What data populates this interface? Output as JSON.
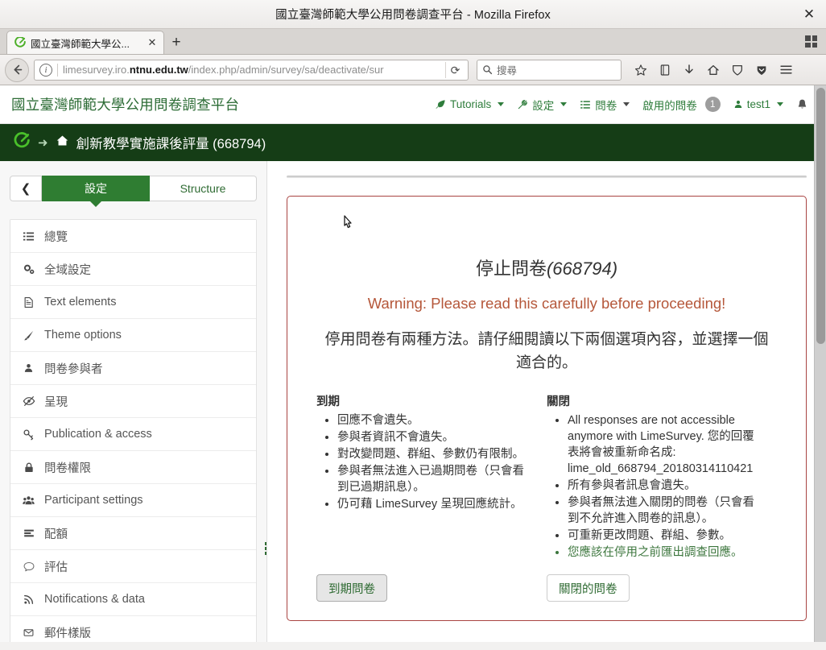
{
  "browser": {
    "window_title": "國立臺灣師範大學公用問卷調查平台 - Mozilla Firefox",
    "close_label": "✕",
    "tab": {
      "title": "國立臺灣師範大學公...",
      "close_label": "✕",
      "new_tab_label": "+"
    },
    "toolbar": {
      "back_label": "❮",
      "url_prefix": "limesurvey.iro.",
      "url_domain": "ntnu.edu.tw",
      "url_path": "/index.php/admin/survey/sa/deactivate/sur",
      "info_label": "i",
      "reload_label": "⟳",
      "search_placeholder": "搜尋"
    }
  },
  "app": {
    "brand": "國立臺灣師範大學公用問卷調查平台",
    "menu": [
      {
        "label": "Tutorials",
        "icon": "rocket-icon",
        "caret": true
      },
      {
        "label": "設定",
        "icon": "wrench-icon",
        "caret": true
      },
      {
        "label": "問卷",
        "icon": "list-icon",
        "caret": true
      },
      {
        "label": "啟用的問卷",
        "icon": "",
        "badge": "1",
        "caret": false
      },
      {
        "label": "test1",
        "icon": "user-icon",
        "caret": true
      },
      {
        "label": "",
        "icon": "bell-icon",
        "caret": false
      }
    ],
    "breadcrumb": {
      "logo": "limesurvey-logo-icon",
      "arrow": "➜",
      "home_icon": "home-icon",
      "text": "創新教學實施課後評量 (668794)"
    }
  },
  "sidebar": {
    "collapse_label": "❮",
    "tabs": [
      {
        "label": "設定",
        "active": true
      },
      {
        "label": "Structure",
        "active": false
      }
    ],
    "items": [
      {
        "label": "總覽",
        "icon": "list-icon"
      },
      {
        "label": "全域設定",
        "icon": "gears-icon"
      },
      {
        "label": "Text elements",
        "icon": "file-text-icon"
      },
      {
        "label": "Theme options",
        "icon": "paintbrush-icon"
      },
      {
        "label": "問卷參與者",
        "icon": "user-icon"
      },
      {
        "label": "呈現",
        "icon": "eye-slash-icon"
      },
      {
        "label": "Publication & access",
        "icon": "key-icon"
      },
      {
        "label": "問卷權限",
        "icon": "lock-icon"
      },
      {
        "label": "Participant settings",
        "icon": "users-icon"
      },
      {
        "label": "配額",
        "icon": "bars-icon"
      },
      {
        "label": "評估",
        "icon": "comment-icon"
      },
      {
        "label": "Notifications & data",
        "icon": "rss-icon"
      },
      {
        "label": "郵件樣版",
        "icon": "envelope-icon"
      }
    ]
  },
  "main": {
    "title_prefix": "停止問卷",
    "title_id": "(668794)",
    "warning": "Warning: Please read this carefully before proceeding!",
    "lead": "停用問卷有兩種方法。請仔細閱讀以下兩個選項內容，並選擇一個適合的。",
    "columns": [
      {
        "heading": "到期",
        "bullets": [
          {
            "text": "回應不會遺失。",
            "note": false
          },
          {
            "text": "參與者資訊不會遺失。",
            "note": false
          },
          {
            "text": "對改變問題、群組、參數仍有限制。",
            "note": false
          },
          {
            "text": "參與者無法進入已過期問卷（只會看到已過期訊息）。",
            "note": false
          },
          {
            "text": "仍可藉 LimeSurvey 呈現回應統計。",
            "note": false
          }
        ],
        "button": "到期問卷",
        "button_hovered": true
      },
      {
        "heading": "關閉",
        "bullets": [
          {
            "text": "All responses are not accessible anymore with LimeSurvey. 您的回覆表將會被重新命名成: lime_old_668794_20180314110421",
            "note": false
          },
          {
            "text": "所有參與者訊息會遺失。",
            "note": false
          },
          {
            "text": "參與者無法進入關閉的問卷（只會看到不允許進入問卷的訊息）。",
            "note": false
          },
          {
            "text": "可重新更改問題、群組、參數。",
            "note": false
          },
          {
            "text": "您應該在停用之前匯出調查回應。",
            "note": true
          }
        ],
        "button": "關閉的問卷",
        "button_hovered": false
      }
    ]
  },
  "colors": {
    "brand_green": "#2f7d32",
    "dark_green": "#153d16",
    "warn_red": "#b5573a",
    "panel_border": "#a94442",
    "note_green": "#3c763d"
  }
}
